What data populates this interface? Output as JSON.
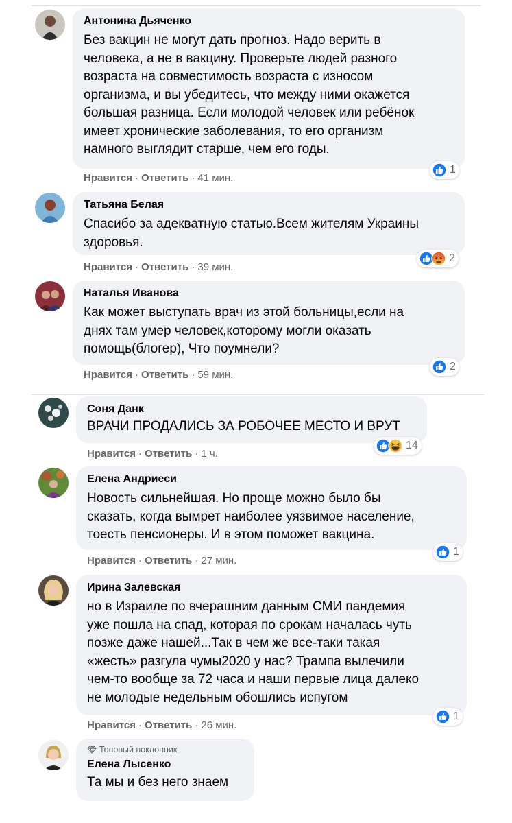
{
  "actions": {
    "like": "Нравится",
    "reply": "Ответить",
    "sep": "·"
  },
  "colors": {
    "bubble": "#f0f2f5",
    "like_blue": "#1877f2",
    "muted": "#65676b",
    "text": "#050505"
  },
  "comments": [
    {
      "author": "Антонина Дьяченко",
      "text": "Без вакцин не могут дать прогноз. Надо верить в\nчеловека, а не в вакцину. Проверьте людей разного\nвозраста на совместимость возраста с износом\nорганизма, и вы убедитесь, что между ними окажется\nбольшая разница. Если молодой человек или ребёнок\nимеет хронические заболевания, то его организм\nнамного выглядит старше, чем его годы.",
      "time": "41 мин.",
      "reactions": {
        "icons": [
          "like-icon"
        ],
        "count": "1"
      }
    },
    {
      "author": "Татьяна Белая",
      "text": "Спасибо за адекватную статью.Всем жителям Украины\nздоровья.",
      "time": "39 мин.",
      "reactions": {
        "icons": [
          "like-icon",
          "angry-icon"
        ],
        "count": "2"
      }
    },
    {
      "author": "Наталья Иванова",
      "text": "Как может выступать врач из этой больницы,если на\nднях там умер человек,которому могли оказать\nпомощь(блогер), Что поумнели?",
      "time": "59 мин.",
      "reactions": {
        "icons": [
          "like-icon"
        ],
        "count": "2"
      }
    },
    {
      "author": "Соня Данк",
      "text": "ВРАЧИ ПРОДАЛИСЬ ЗА РОБОЧЕЕ МЕСТО И ВРУТ",
      "time": "1 ч.",
      "reactions": {
        "icons": [
          "like-icon",
          "haha-icon"
        ],
        "count": "14"
      }
    },
    {
      "author": "Елена Андриеси",
      "text": "Новость сильнейшая. Но проще можно было бы\nсказать, когда вымрет наиболее уязвимое население,\nтоесть пенсионеры. И в этом поможет вакцина.",
      "time": "27 мин.",
      "reactions": {
        "icons": [
          "like-icon"
        ],
        "count": "1"
      }
    },
    {
      "author": "Ирина Залевская",
      "text": "но в Израиле по вчерашним данным СМИ пандемия\nуже пошла на спад, которая по срокам началась чуть\nпозже даже нашей...Так в чем же все-таки такая\n«жесть» разгула чумы2020 у нас? Трампа вылечили\nчем-то вообще за 72 часа и наши первые лица далеко\nне молодые недельным обошлись испугом",
      "time": "26 мин.",
      "reactions": {
        "icons": [
          "like-icon"
        ],
        "count": "1"
      }
    },
    {
      "author": "Елена Лысенко",
      "badge": "Топовый поклонник",
      "text": "Та мы и без него знаем"
    }
  ]
}
